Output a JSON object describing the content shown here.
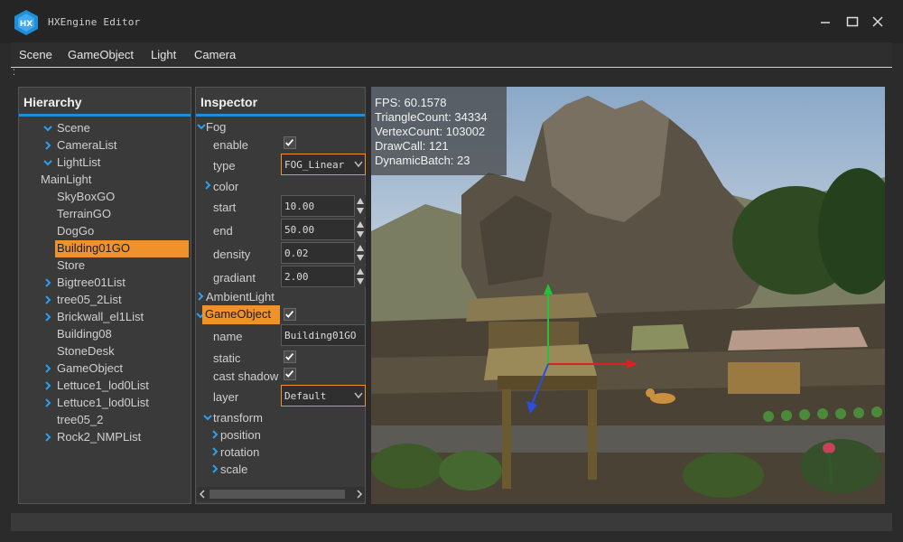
{
  "window": {
    "title": "HXEngine Editor",
    "logo_text": "HX"
  },
  "menu": [
    "Scene",
    "GameObject",
    "Light",
    "Camera"
  ],
  "hierarchy": {
    "title": "Hierarchy",
    "root": "Scene",
    "items": [
      {
        "label": "CameraList",
        "arrow": "right"
      },
      {
        "label": "LightList",
        "arrow": "down"
      },
      {
        "label": "MainLight",
        "arrow": ""
      },
      {
        "label": "SkyBoxGO",
        "arrow": ""
      },
      {
        "label": "TerrainGO",
        "arrow": ""
      },
      {
        "label": "DogGo",
        "arrow": ""
      },
      {
        "label": "Building01GO",
        "arrow": "",
        "selected": true
      },
      {
        "label": "Store",
        "arrow": ""
      },
      {
        "label": "Bigtree01List",
        "arrow": "right"
      },
      {
        "label": "tree05_2List",
        "arrow": "right"
      },
      {
        "label": "Brickwall_el1List",
        "arrow": "right"
      },
      {
        "label": "Building08",
        "arrow": ""
      },
      {
        "label": "StoneDesk",
        "arrow": ""
      },
      {
        "label": "GameObject",
        "arrow": "right"
      },
      {
        "label": "Lettuce1_lod0List",
        "arrow": "right"
      },
      {
        "label": "Lettuce1_lod0List",
        "arrow": "right"
      },
      {
        "label": "tree05_2",
        "arrow": ""
      },
      {
        "label": "Rock2_NMPList",
        "arrow": "right"
      }
    ]
  },
  "inspector": {
    "title": "Inspector",
    "fog": {
      "label": "Fog",
      "enable_label": "enable",
      "enable": true,
      "type_label": "type",
      "type_value": "FOG_Linear",
      "color_label": "color",
      "start_label": "start",
      "start_value": "10.00",
      "end_label": "end",
      "end_value": "50.00",
      "density_label": "density",
      "density_value": "0.02",
      "gradiant_label": "gradiant",
      "gradiant_value": "2.00"
    },
    "ambient_label": "AmbientLight",
    "gameobject": {
      "label": "GameObject",
      "enabled": true,
      "name_label": "name",
      "name_value": "Building01GO",
      "static_label": "static",
      "static": true,
      "cast_shadow_label": "cast shadow",
      "cast_shadow": true,
      "layer_label": "layer",
      "layer_value": "Default",
      "transform_label": "transform",
      "position_label": "position",
      "rotation_label": "rotation",
      "scale_label": "scale"
    }
  },
  "stats": {
    "fps": "FPS: 60.1578",
    "triangles": "TriangleCount: 34334",
    "vertices": "VertexCount: 103002",
    "drawcall": "DrawCall: 121",
    "dynamic_batch": "DynamicBatch: 23"
  },
  "colors": {
    "accent_blue": "#1e8ed6",
    "selection_orange": "#f0922c",
    "gizmo_y": "#22c33a",
    "gizmo_x": "#e02020",
    "gizmo_z": "#2a4fe0"
  }
}
